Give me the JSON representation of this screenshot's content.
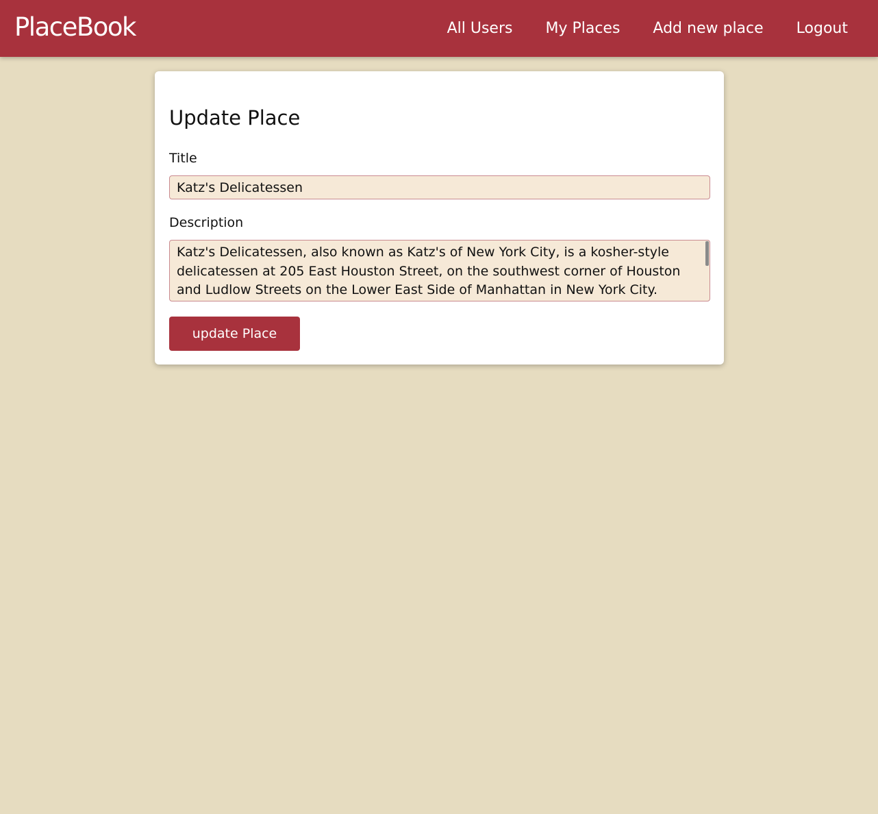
{
  "navbar": {
    "brand": "PlaceBook",
    "links": [
      {
        "label": "All Users"
      },
      {
        "label": "My Places"
      },
      {
        "label": "Add new place"
      },
      {
        "label": "Logout"
      }
    ]
  },
  "form": {
    "heading": "Update Place",
    "title_label": "Title",
    "title_value": "Katz's Delicatessen",
    "description_label": "Description",
    "description_value": "Katz's Delicatessen, also known as Katz's of New York City, is a kosher-style delicatessen at 205 East Houston Street, on the southwest corner of Houston and Ludlow Streets on the Lower East Side of Manhattan in New York City.",
    "submit_label": "update Place"
  },
  "colors": {
    "primary": "#a8323d",
    "background": "#e6dcc0",
    "input_background": "#f6e9d7"
  }
}
